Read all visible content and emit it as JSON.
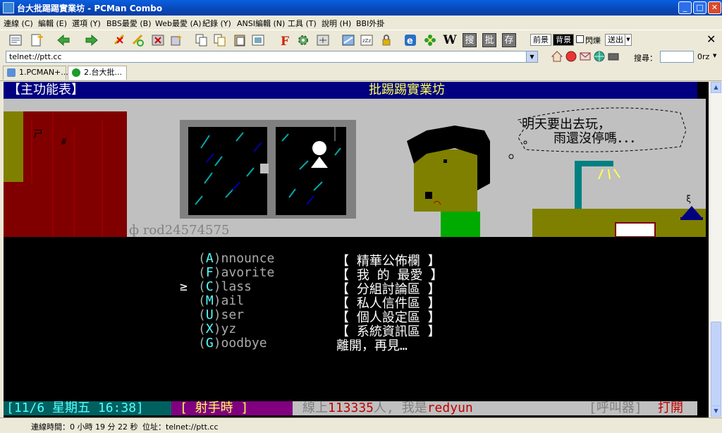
{
  "window": {
    "title": "台大批踢踢實業坊 - PCMan Combo",
    "buttons": {
      "minimize": "_",
      "maximize": "□",
      "close": "✕"
    }
  },
  "menu": [
    "連線 (C)",
    "編輯 (E)",
    "選項 (Y)",
    "BBS最愛 (B)",
    "Web最愛 (A)",
    "紀錄 (Y)",
    "ANSI編輯 (N)",
    "工具 (T)",
    "說明 (H)",
    "BBI外掛"
  ],
  "toolbar": {
    "prev_label": "前景",
    "bg_label": "背景",
    "blink_label": "閃爍",
    "send_label": "送出",
    "search_letter_w": "W",
    "search_sou": "搜",
    "search_pi": "批",
    "search_cun": "存",
    "search_label": "搜尋：",
    "search_value": "",
    "lang_value": "0rz"
  },
  "address": {
    "value": "telnet://ptt.cc"
  },
  "tabs": [
    {
      "label": "1.PCMAN+..."
    },
    {
      "label": "2.台大批..."
    }
  ],
  "terminal": {
    "header_left": "【主功能表】",
    "header_title": "批踢踢實業坊",
    "thought": [
      "明天要出去玩，",
      "雨還沒停嗎．．．"
    ],
    "artist": "ф rod24574575",
    "menu_items": [
      {
        "key": "A",
        "rest": "nnounce",
        "desc": "【 精華公佈欄 】"
      },
      {
        "key": "F",
        "rest": "avorite",
        "desc": "【 我 的 最愛 】"
      },
      {
        "key": "C",
        "rest": "lass",
        "desc": "【 分組討論區 】"
      },
      {
        "key": "M",
        "rest": "ail",
        "desc": "【 私人信件區 】"
      },
      {
        "key": "U",
        "rest": "ser",
        "desc": "【 個人設定區 】"
      },
      {
        "key": "X",
        "rest": "yz",
        "desc": "【 系統資訊區 】"
      },
      {
        "key": "G",
        "rest": "oodbye",
        "desc": "  離開，再見…"
      }
    ],
    "cursor": "≥",
    "status_date": "[11/6 星期五 16:38]",
    "status_sign": "[ 射手時 ]",
    "status_online_prefix": "線上",
    "status_online_count": "113335",
    "status_online_suffix": "人, 我是",
    "status_user": "redyun",
    "status_pager_label": "[呼叫器]",
    "status_pager_state": "打開"
  },
  "statusbar": {
    "conn_time": "連線時間：0 小時 19 分 22 秒",
    "address": "位址：telnet://ptt.cc"
  }
}
